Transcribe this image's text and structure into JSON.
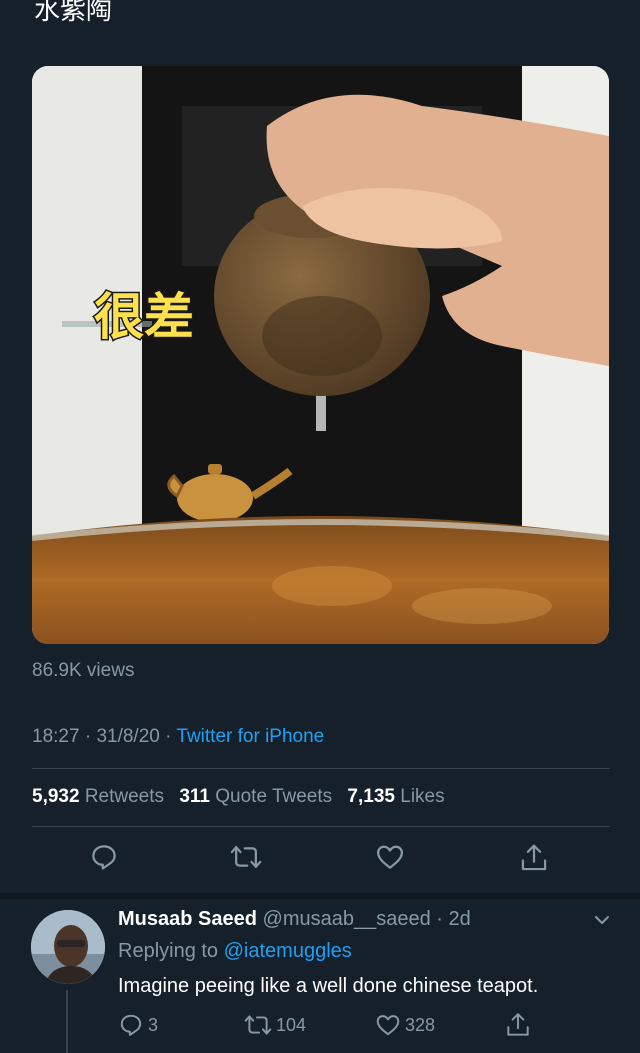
{
  "header": {
    "partial_text": "水紫陶"
  },
  "media": {
    "overlay_caption": "很差"
  },
  "tweet": {
    "views": "86.9K views",
    "time": "18:27",
    "date": "31/8/20",
    "dot": "·",
    "client": "Twitter for iPhone",
    "retweets_count": "5,932",
    "retweets_label": "Retweets",
    "quotes_count": "311",
    "quotes_label": "Quote Tweets",
    "likes_count": "7,135",
    "likes_label": "Likes"
  },
  "actions": {
    "reply_icon": "reply-icon",
    "retweet_icon": "retweet-icon",
    "like_icon": "heart-icon",
    "share_icon": "share-icon"
  },
  "reply": {
    "name": "Musaab Saeed",
    "handle": "@musaab__saeed",
    "time": "2d",
    "replying_to_label": "Replying to",
    "replying_to_handle": "@iatemuggles",
    "text": "Imagine peeing like a well done chinese teapot.",
    "reply_count": "3",
    "retweet_count": "104",
    "like_count": "328"
  },
  "colors": {
    "background": "#15202b",
    "accent": "#1da1f2",
    "muted": "#8899a6",
    "divider": "#38444d"
  }
}
